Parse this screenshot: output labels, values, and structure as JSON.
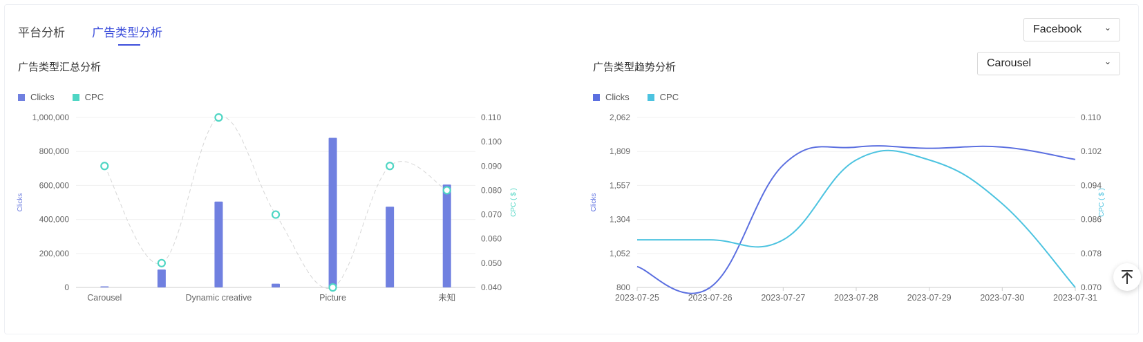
{
  "tabs": [
    {
      "label": "平台分析",
      "active": false
    },
    {
      "label": "广告类型分析",
      "active": true
    }
  ],
  "platform_select": {
    "value": "Facebook",
    "icon": "chevron-down-icon"
  },
  "adtype_select": {
    "value": "Carousel",
    "icon": "chevron-down-icon"
  },
  "left_panel": {
    "title": "广告类型汇总分析"
  },
  "right_panel": {
    "title": "广告类型趋势分析"
  },
  "colors": {
    "accent": "#3b4ddb",
    "clicks": "#7080e0",
    "cpc_left": "#4fd6c4",
    "cpc_right": "#4cc3e0",
    "clicks_line": "#5b6fe0"
  },
  "back_to_top": {
    "icon": "arrow-up-to-line-icon"
  },
  "chart_data": [
    {
      "type": "bar",
      "title": "广告类型汇总分析",
      "legend": [
        "Clicks",
        "CPC"
      ],
      "legend_position": "top-left",
      "categories": [
        "Carousel",
        "",
        "Dynamic creative",
        "",
        "Picture",
        "",
        "未知"
      ],
      "x_tick_labels": [
        "Carousel",
        "Dynamic creative",
        "Picture",
        "未知"
      ],
      "ylabel": "Clicks",
      "y2label": "CPC ( $ )",
      "ylim": [
        0,
        1000000
      ],
      "y2lim": [
        0.04,
        0.11
      ],
      "y_ticks": [
        "0",
        "200,000",
        "400,000",
        "600,000",
        "800,000",
        "1,000,000"
      ],
      "y2_ticks": [
        "0.040",
        "0.050",
        "0.060",
        "0.070",
        "0.080",
        "0.090",
        "0.100",
        "0.110"
      ],
      "series": [
        {
          "name": "Clicks",
          "type": "bar",
          "values": [
            6000,
            105000,
            505000,
            22000,
            880000,
            475000,
            605000
          ]
        },
        {
          "name": "CPC",
          "type": "line",
          "values": [
            0.09,
            0.05,
            0.11,
            0.07,
            0.04,
            0.09,
            0.08
          ]
        }
      ],
      "grid": true
    },
    {
      "type": "line",
      "title": "广告类型趋势分析",
      "legend": [
        "Clicks",
        "CPC"
      ],
      "legend_position": "top-left",
      "x": [
        "2023-07-25",
        "2023-07-26",
        "2023-07-27",
        "2023-07-28",
        "2023-07-29",
        "2023-07-30",
        "2023-07-31"
      ],
      "ylabel": "Clicks",
      "y2label": "CPC ( $ )",
      "ylim": [
        800,
        2062
      ],
      "y2lim": [
        0.07,
        0.11
      ],
      "y_ticks": [
        "800",
        "1,052",
        "1,304",
        "1,557",
        "1,809",
        "2,062"
      ],
      "y2_ticks": [
        "0.070",
        "0.078",
        "0.086",
        "0.094",
        "0.102",
        "0.110"
      ],
      "series": [
        {
          "name": "Clicks",
          "values": [
            955,
            800,
            1709,
            1842,
            1833,
            1842,
            1750
          ]
        },
        {
          "name": "CPC",
          "values": [
            0.0812,
            0.0812,
            0.0812,
            0.1,
            0.1,
            0.0897,
            0.07
          ]
        }
      ],
      "grid": true
    }
  ]
}
